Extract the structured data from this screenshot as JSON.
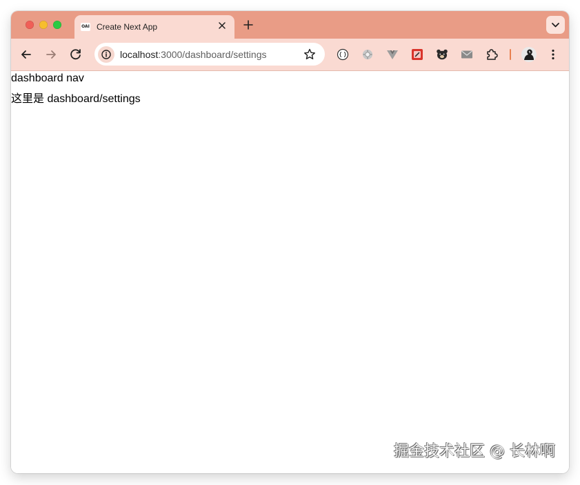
{
  "browser": {
    "tab": {
      "favicon_text": "OAI",
      "title": "Create Next App"
    },
    "omnibox": {
      "host": "localhost",
      "path": ":3000/dashboard/settings"
    },
    "extensions": [
      "braces-extension-icon",
      "gear-extension-icon",
      "vue-devtools-icon",
      "color-picker-icon",
      "bear-icon",
      "mail-icon",
      "puzzle-extensions-icon",
      "profile-avatar-icon"
    ]
  },
  "page": {
    "nav_text": "dashboard nav",
    "settings_text": "这里是 dashboard/settings"
  },
  "watermark": "掘金技术社区 @ 长林啊",
  "colors": {
    "tabbar": "#e99c86",
    "toolbar": "#fadad2",
    "separator": "#e8804f"
  }
}
